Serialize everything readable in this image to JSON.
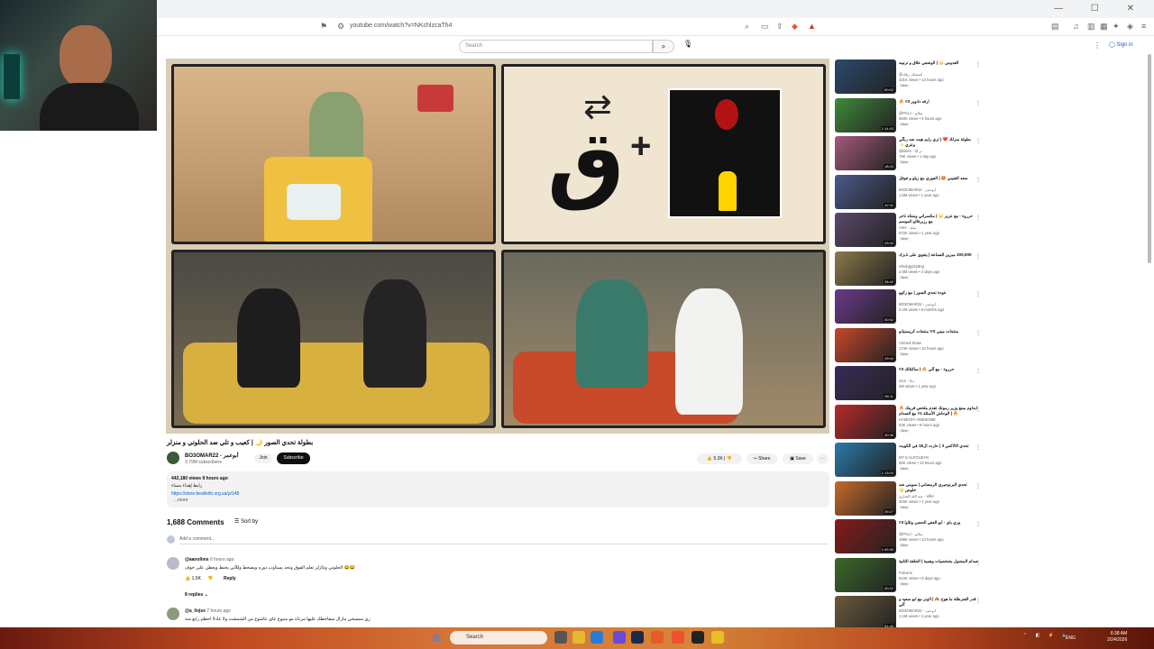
{
  "browser": {
    "url": "youtube.com/watch?v=NKchlzcaTh4",
    "window_controls": "— ☐ ✕"
  },
  "youtube": {
    "search_placeholder": "Search",
    "sign_in": "Sign in"
  },
  "video": {
    "title": "بطولة تحدي الصور 🌙 | كعيب و تلي ضد الحلوتي و منزلر",
    "overlay_glyph": "ق",
    "channel": "BO3OMAR22 - أبوعمر",
    "subscribers": "3.79M subscribers",
    "join": "Join",
    "subscribe": "Subscribe",
    "likes": "5.3K",
    "share": "Share",
    "save": "Save",
    "description": {
      "stats": "442,180 views  9 hours ago",
      "line": "رابط إهداء مساء",
      "link": "https://store.bealleith.org.sa/p/148",
      "more": "...more"
    }
  },
  "comments": {
    "count": "1,688 Comments",
    "sort": "Sort by",
    "add_placeholder": "Add a comment...",
    "items": [
      {
        "author": "@aanolims",
        "time": "6 hours ago",
        "text": "الحلوتي وغازلز نعلم الفوق وتحد يستاوب دوره ويضحط وللآتي يحتط ويعطن على حوف 😂😂",
        "likes": "1.5K",
        "reply": "Reply"
      },
      {
        "author": "@a_livjsx",
        "time": "7 hours ago",
        "text": "ري ممسحي مازال سفاحطك عليها مرداة مو منيوع عاي عاشوع من الشمشت ولا عادلا احظم رابع منه"
      }
    ],
    "replies": "8 replies"
  },
  "sidebar": [
    {
      "title": "الغدوس 🔱 | الوضعي علاق و ترتيبه",
      "channel": "@أشجعك ريلك",
      "views": "431K views • 13 hours ago",
      "duration": "50:02",
      "new": "New",
      "color": "#2b4a6e"
    },
    {
      "title": "أرقه دانوير 3# 🔥",
      "channel": "@PALz - سالم",
      "views": "363K views • 8 hours ago",
      "duration": "1:14:43",
      "new": "New",
      "color": "#3f8a3a"
    },
    {
      "title": "بطولة منزلك ❤️ | ثري رايم هيت ضد رنگي وعزي ✨",
      "channel": "@Bo0x - 3t نر",
      "views": "79K views • 1 day ago",
      "duration": "18:03",
      "new": "New",
      "color": "#a55a7a"
    },
    {
      "title": "سعد العتيبي 🤩 | الفوزي مع زيلو و فوفل",
      "channel": "BO3OMAR22 - أبوعمر",
      "views": "1.5M views • 1 year ago",
      "duration": "42:11",
      "new": "",
      "color": "#4a5a8a"
    },
    {
      "title": "حرروء - مع عزيز 🔱 | مكسراتي ومنتاه ناجر مع رزيرفالو الموسم",
      "channel": "Ams - شلد",
      "views": "972K views • 1 year ago",
      "duration": "43:40",
      "new": "New",
      "color": "#5a4a6a"
    },
    {
      "title": "100,000 مبزين الصناعة | يتفوي على 1بزك",
      "channel": "Shulogy/Zy8ng",
      "views": "2.8M views • 2 days ago",
      "duration": "38:42",
      "new": "New",
      "color": "#8a7a4a"
    },
    {
      "title": "عودة تحدي الصور | مع زكوو",
      "channel": "BO3OMAR22 - أبوعمر",
      "views": "2.1M views • 6 months ago",
      "duration": "30:52",
      "new": "",
      "color": "#6a3a8a"
    },
    {
      "title": "منتجات ميني VS منتجات كريستيانو",
      "channel": "Ahmed Shaw",
      "views": "174K views • 12 hours ago",
      "duration": "19:04",
      "new": "New",
      "color": "#c8462a"
    },
    {
      "title": "حرروء - مع آلي 🔥 | ساكتالك 3#",
      "channel": "SLS - 3ت",
      "views": "2M views • 1 year ago",
      "duration": "58:11",
      "new": "",
      "color": "#3a2a5a"
    },
    {
      "title": "ابداوم بمنع وزير رمونك تقدم ملخص قرينك 🔥 🔥 | الوحاش الأسئلة 1# مع الصدام",
      "channel": "HAMODY AWESOME",
      "views": "53K views • 9 hours ago",
      "duration": "30:36",
      "new": "New",
      "color": "#b82a2a"
    },
    {
      "title": "تحدي الالاكس 3 | حارت ال$1 في الكويت",
      "channel": "M7.S ALFOUZAN",
      "views": "86K views • 13 hours ago",
      "duration": "1:13:04",
      "new": "New",
      "color": "#2a7aaa"
    },
    {
      "title": "تحدي البرتوجيري الرمضاني | سويني ضد خلوص 🔱",
      "channel": "عبد الله الضاري - elfer",
      "views": "303K views • 1 year ago",
      "duration": "39:27",
      "new": "New",
      "color": "#c86a2a"
    },
    {
      "title": "وري باي - أبو العص الحصن وتلاوا 3#",
      "channel": "@PALz - سالم",
      "views": "198K views • 13 hours ago",
      "duration": "1:09:30",
      "new": "New",
      "color": "#8a1a1a"
    },
    {
      "title": "صدام المجنول بشخصيات وهمية | الحلقة الثانية",
      "channel": "Falcons",
      "views": "810K views • 5 days ago",
      "duration": "40:22",
      "new": "New",
      "color": "#3a6a2a"
    },
    {
      "title": "قدر الفترطلة ما هوح 🙈 | الوتر مع ابو سعيد و آلي",
      "channel": "BO3OMAR22 - أبوعمر",
      "views": "1.1M views • 1 year ago",
      "duration": "51:49",
      "new": "",
      "color": "#6a5a3a"
    }
  ],
  "taskbar": {
    "search": "Search",
    "lang": "ENG",
    "time": "6:38 AM",
    "date": "2/24/2026"
  }
}
